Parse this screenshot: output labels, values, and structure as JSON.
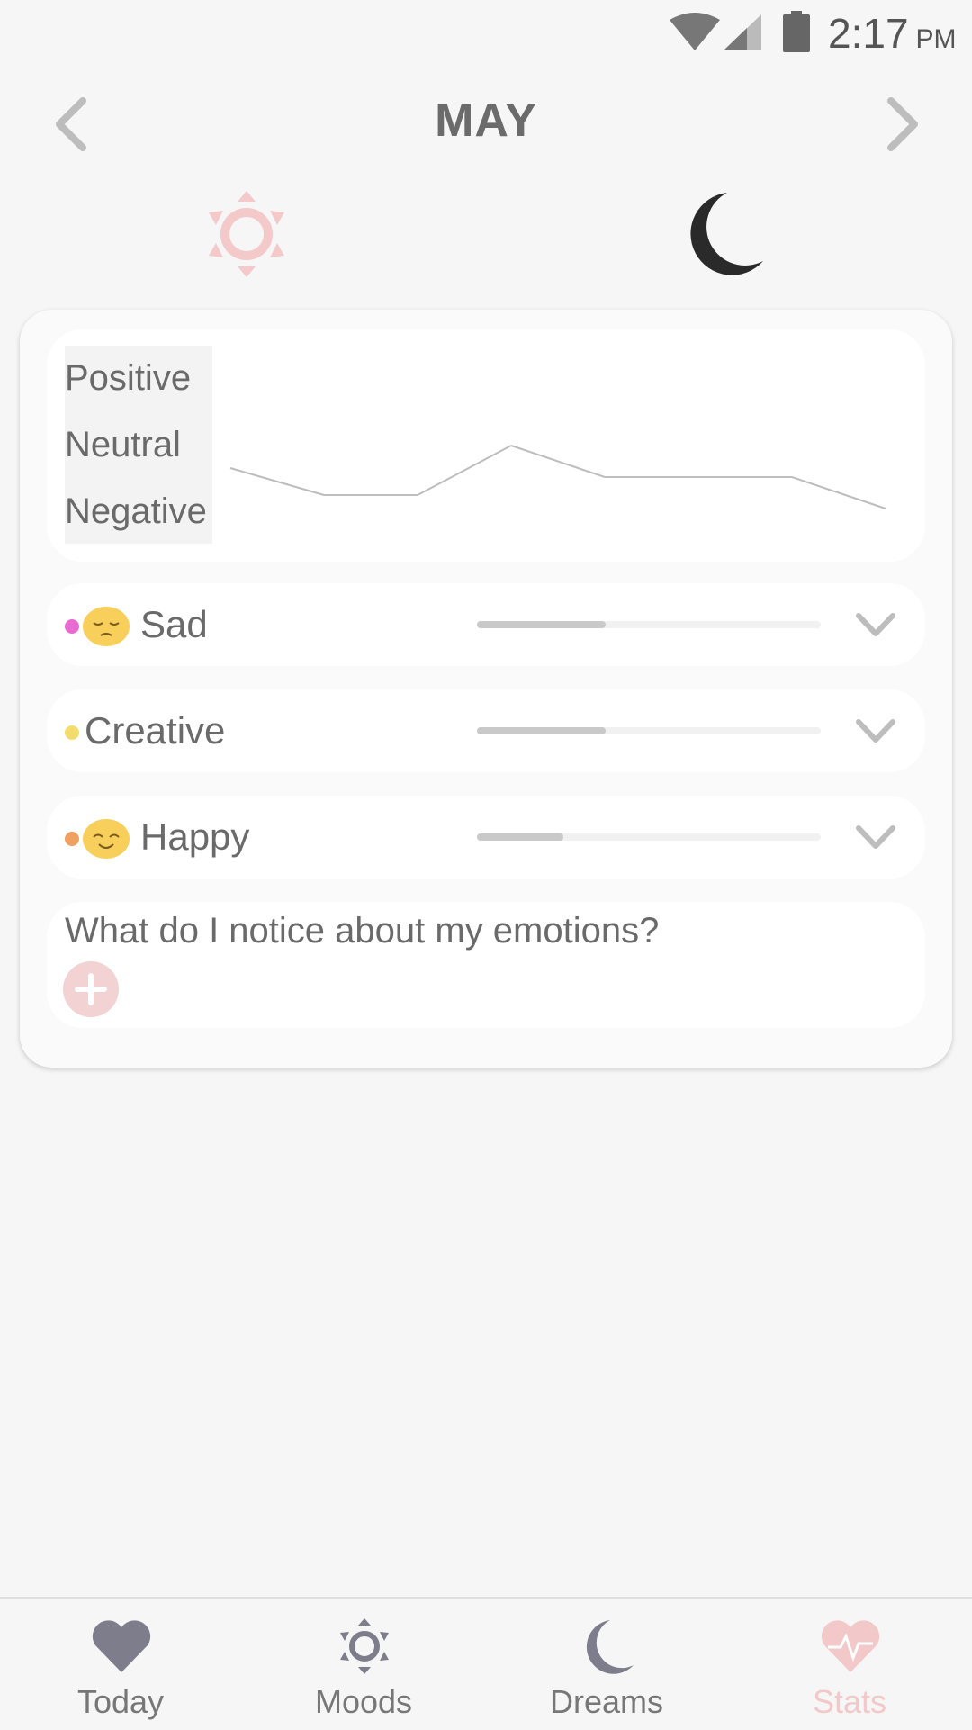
{
  "status_bar": {
    "time": "2:17",
    "ampm": "PM"
  },
  "header": {
    "month": "MAY"
  },
  "chart": {
    "y_levels": [
      "Positive",
      "Neutral",
      "Negative"
    ],
    "line_color": "#bdbdbd"
  },
  "chart_data": {
    "type": "line",
    "title": "",
    "xlabel": "",
    "ylabel": "",
    "y_categories": [
      "Negative",
      "Neutral",
      "Positive"
    ],
    "series": [
      {
        "values": [
          0.7,
          0.1,
          0.1,
          1.2,
          0.5,
          0.5,
          0.5,
          -0.2
        ]
      }
    ],
    "ylim": [
      -0.5,
      2.5
    ]
  },
  "emotions": [
    {
      "label": "Sad",
      "dot_color": "#e86bd2",
      "emoji": "sad-face-icon",
      "level": 0.375
    },
    {
      "label": "Creative",
      "dot_color": "#f2dd6c",
      "emoji": "",
      "level": 0.375
    },
    {
      "label": "Happy",
      "dot_color": "#f0a060",
      "emoji": "happy-face-icon",
      "level": 0.25
    }
  ],
  "notes": {
    "prompt": "What do I notice about my emotions?"
  },
  "bottom_nav": {
    "items": [
      {
        "label": "Today",
        "icon": "heart-icon",
        "color": "#6f6f7f"
      },
      {
        "label": "Moods",
        "icon": "sun-icon",
        "color": "#6f6f7f"
      },
      {
        "label": "Dreams",
        "icon": "moon-icon",
        "color": "#6f6f7f"
      },
      {
        "label": "Stats",
        "icon": "heart-pulse-icon",
        "color": "#f2c8c8"
      }
    ]
  },
  "colors": {
    "background": "#f6f6f6",
    "accent_pink": "#f2cccc",
    "text": "#6a6a6a"
  }
}
